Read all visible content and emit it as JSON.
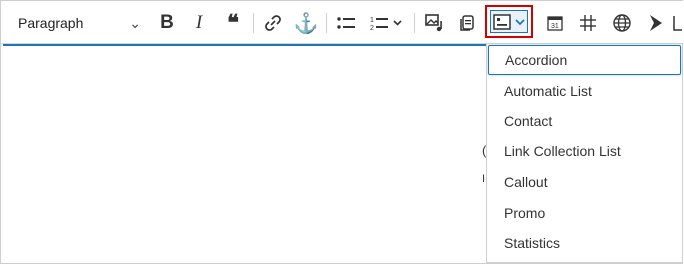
{
  "toolbar": {
    "paragraph_select": {
      "value": "Paragraph"
    },
    "buttons": [
      {
        "name": "bold",
        "glyph": "B"
      },
      {
        "name": "italic",
        "glyph": "I"
      },
      {
        "name": "blockquote",
        "glyph": "❝"
      },
      {
        "name": "link"
      },
      {
        "name": "anchor",
        "glyph": "⚓"
      },
      {
        "name": "bulleted-list"
      },
      {
        "name": "numbered-list"
      },
      {
        "name": "media"
      },
      {
        "name": "copy"
      },
      {
        "name": "insert-block"
      },
      {
        "name": "calendar",
        "label": "31"
      },
      {
        "name": "grid"
      },
      {
        "name": "globe"
      },
      {
        "name": "arrow"
      }
    ],
    "accent_color": "#1e73be",
    "highlight_color": "#d40000"
  },
  "dropdown": {
    "items": [
      {
        "label": "Accordion",
        "active": true
      },
      {
        "label": "Automatic List"
      },
      {
        "label": "Contact"
      },
      {
        "label": "Link Collection List"
      },
      {
        "label": "Callout"
      },
      {
        "label": "Promo"
      },
      {
        "label": "Statistics"
      }
    ]
  }
}
